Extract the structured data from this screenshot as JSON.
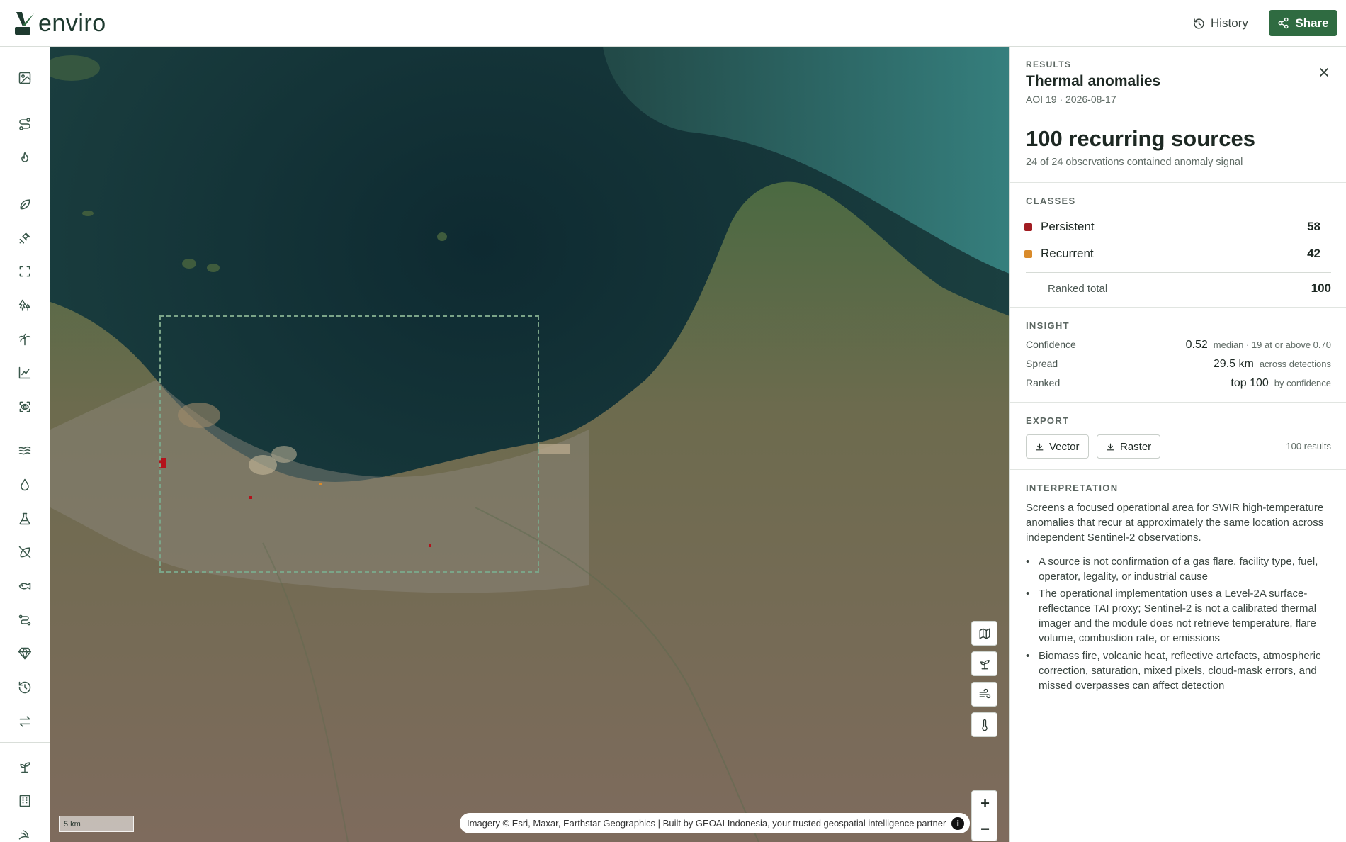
{
  "app": {
    "logo_text": "enviro"
  },
  "header": {
    "history_label": "History",
    "share_label": "Share"
  },
  "rail": {
    "icons": [
      "image-icon",
      "route-icon",
      "flame-icon",
      "leaf-icon",
      "satellite-icon",
      "scan-frame-icon",
      "trees-icon",
      "palm-tree-icon",
      "line-chart-icon",
      "scan-eye-icon",
      "waves-icon",
      "droplet-icon",
      "flask-icon",
      "leaf-off-icon",
      "fish-icon",
      "route-alt-icon",
      "gem-icon",
      "history-icon",
      "arrows-exchange-icon",
      "sprout-icon",
      "building-icon",
      "rabbit-icon"
    ]
  },
  "map": {
    "scale_label": "5 km",
    "attribution": "Imagery © Esri, Maxar, Earthstar Geographics | Built by GEOAI Indonesia, your trusted geospatial intelligence partner",
    "info_glyph": "i",
    "zoom_in": "+",
    "zoom_out": "−"
  },
  "results": {
    "eyebrow": "RESULTS",
    "title": "Thermal anomalies",
    "subtitle": "AOI 19 · 2026-08-17",
    "headline": "100 recurring sources",
    "headline_sub": "24 of 24 observations contained anomaly signal",
    "classes_label": "CLASSES",
    "classes": [
      {
        "name": "Persistent",
        "count": "58",
        "color": "#a11d22"
      },
      {
        "name": "Recurrent",
        "count": "42",
        "color": "#d98b2b"
      }
    ],
    "ranked_total_label": "Ranked total",
    "ranked_total": "100",
    "insight_label": "INSIGHT",
    "insights": [
      {
        "label": "Confidence",
        "value": "0.52",
        "note": "median · 19 at or above 0.70"
      },
      {
        "label": "Spread",
        "value": "29.5 km",
        "note": "across detections"
      },
      {
        "label": "Ranked",
        "value": "top 100",
        "note": "by confidence"
      }
    ],
    "export_label": "EXPORT",
    "export_vector": "Vector",
    "export_raster": "Raster",
    "export_count": "100 results",
    "interpretation_label": "INTERPRETATION",
    "interpretation": "Screens a focused operational area for SWIR high-temperature anomalies that recur at approximately the same location across independent Sentinel-2 observations.",
    "bullets": [
      "A source is not confirmation of a gas flare, facility type, fuel, operator, legality, or industrial cause",
      "The operational implementation uses a Level-2A surface-reflectance TAI proxy; Sentinel-2 is not a calibrated thermal imager and the module does not retrieve temperature, flare volume, combustion rate, or emissions",
      "Biomass fire, volcanic heat, reflective artefacts, atmospheric correction, saturation, mixed pixels, cloud-mask errors, and missed overpasses can affect detection"
    ]
  }
}
